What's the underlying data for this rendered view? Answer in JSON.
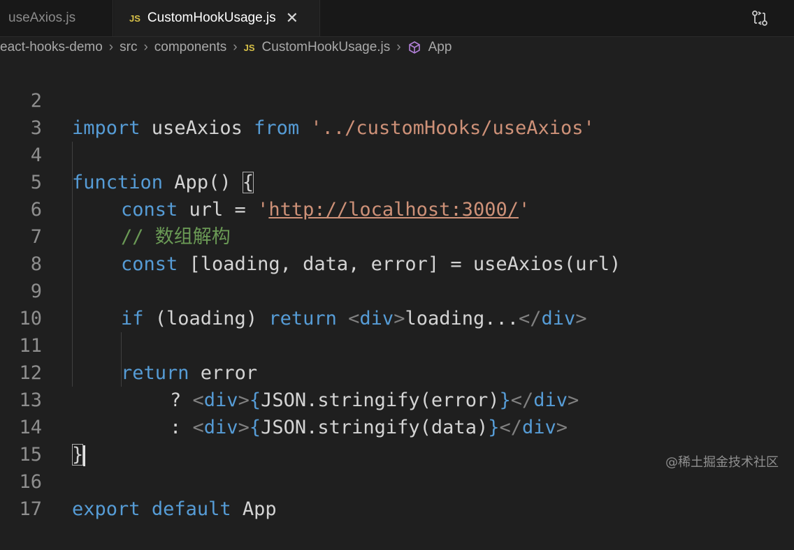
{
  "tabs": [
    {
      "label": "useAxios.js",
      "active": false
    },
    {
      "label": "CustomHookUsage.js",
      "badge": "JS",
      "active": true,
      "close": "✕"
    }
  ],
  "breadcrumb": {
    "items": [
      "eact-hooks-demo",
      "src",
      "components",
      "CustomHookUsage.js",
      "App"
    ],
    "js_badge": "JS",
    "separator": "›"
  },
  "editor": {
    "lines": [
      {
        "n": "2"
      },
      {
        "n": "3"
      },
      {
        "n": "4"
      },
      {
        "n": "5"
      },
      {
        "n": "6"
      },
      {
        "n": "7"
      },
      {
        "n": "8"
      },
      {
        "n": "9"
      },
      {
        "n": "10"
      },
      {
        "n": "11"
      },
      {
        "n": "12"
      },
      {
        "n": "13"
      },
      {
        "n": "14"
      },
      {
        "n": "15"
      },
      {
        "n": "16"
      },
      {
        "n": "17"
      }
    ],
    "tokens": {
      "l2_import": "import",
      "l2_name": " useAxios ",
      "l2_from": "from",
      "l2_sp": " ",
      "l2_path": "'../customHooks/useAxios'",
      "l4_function": "function",
      "l4_name": " App",
      "l4_parens": "() ",
      "l4_brace": "{",
      "l5_const": "const",
      "l5_rest": " url = ",
      "l5_q1": "'",
      "l5_url": "http://localhost:3000/",
      "l5_q2": "'",
      "l6_comment": "// 数组解构",
      "l7_const": "const",
      "l7_rest": " [loading, data, error] = ",
      "l7_fn": "useAxios",
      "l7_args": "(url)",
      "l9_if": "if",
      "l9_cond": " (loading) ",
      "l9_return": "return",
      "l9_sp": " ",
      "l9_lt": "<",
      "l9_div": "div",
      "l9_gt": ">",
      "l9_text": "loading...",
      "l9_lt2": "</",
      "l9_div2": "div",
      "l9_gt2": ">",
      "l11_return": "return",
      "l11_rest": " error",
      "l12_q": "? ",
      "l12_lt": "<",
      "l12_div": "div",
      "l12_gt": ">",
      "l12_ob": "{",
      "l12_expr": "JSON.stringify(error)",
      "l12_cb": "}",
      "l12_lt2": "</",
      "l12_div2": "div",
      "l12_gt2": ">",
      "l13_c": ": ",
      "l13_lt": "<",
      "l13_div": "div",
      "l13_gt": ">",
      "l13_ob": "{",
      "l13_expr": "JSON.stringify(data)",
      "l13_cb": "}",
      "l13_lt2": "</",
      "l13_div2": "div",
      "l13_gt2": ">",
      "l14_brace": "}",
      "l16_export": "export",
      "l16_sp": " ",
      "l16_default": "default",
      "l16_name": " App"
    }
  },
  "watermark": "@稀土掘金技术社区",
  "colors": {
    "keyword": "#569cd6",
    "string": "#ce9178",
    "comment": "#6a9955",
    "function": "#dcdcaa",
    "js_badge": "#d7c048",
    "background": "#1f1f1f"
  },
  "icons": [
    "js-file-icon",
    "close-icon",
    "git-compare-icon",
    "chevron-right-icon",
    "symbol-class-icon"
  ]
}
